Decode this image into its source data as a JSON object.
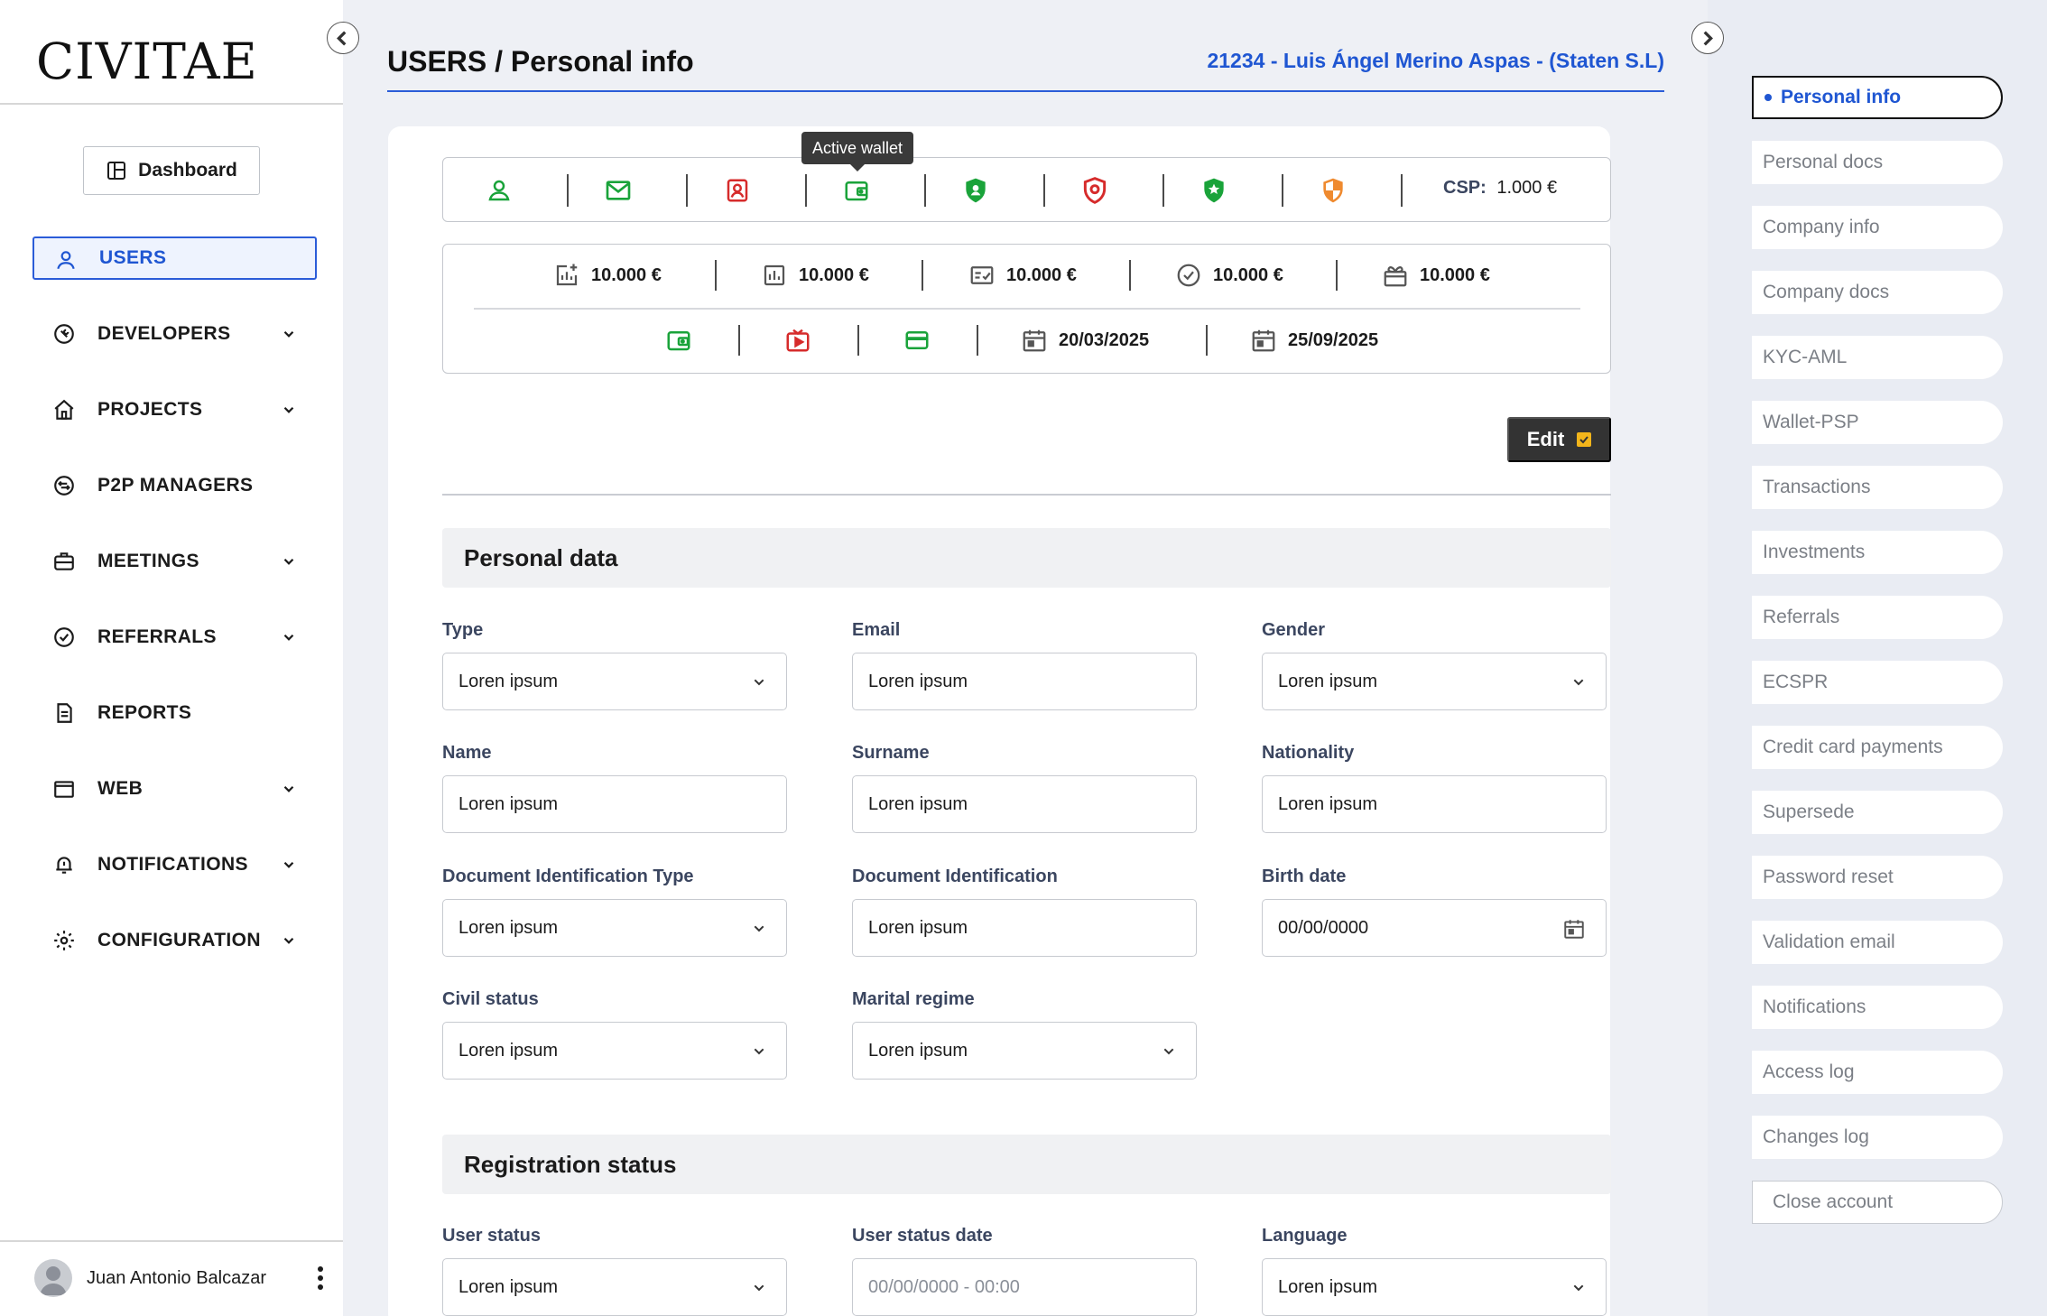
{
  "brand": {
    "logo": "CIVITAE"
  },
  "sidebar": {
    "dashboard_label": "Dashboard",
    "items": [
      {
        "label": "USERS",
        "icon": "user-icon",
        "expandable": false,
        "active": true
      },
      {
        "label": "DEVELOPERS",
        "icon": "wrench-icon",
        "expandable": true
      },
      {
        "label": "PROJECTS",
        "icon": "home-icon",
        "expandable": true
      },
      {
        "label": "P2P MANAGERS",
        "icon": "exchange-icon",
        "expandable": false
      },
      {
        "label": "MEETINGS",
        "icon": "briefcase-icon",
        "expandable": true
      },
      {
        "label": "REFERRALS",
        "icon": "check-circle-icon",
        "expandable": true
      },
      {
        "label": "REPORTS",
        "icon": "document-icon",
        "expandable": false
      },
      {
        "label": "WEB",
        "icon": "browser-icon",
        "expandable": true
      },
      {
        "label": "NOTIFICATIONS",
        "icon": "bell-icon",
        "expandable": true
      },
      {
        "label": "CONFIGURATION",
        "icon": "gear-icon",
        "expandable": true
      }
    ],
    "user_name": "Juan Antonio Balcazar"
  },
  "header": {
    "title": "USERS / Personal info",
    "user_ref": "21234 - Luis Ángel Merino Aspas - (Staten S.L)"
  },
  "status_bar": {
    "icons": [
      {
        "name": "user-status-icon",
        "color": "#1aa33a"
      },
      {
        "name": "email-status-icon",
        "color": "#1aa33a"
      },
      {
        "name": "identity-doc-icon",
        "color": "#d62b2b"
      },
      {
        "name": "wallet-status-icon",
        "color": "#1aa33a"
      },
      {
        "name": "shield-user-icon",
        "color": "#1aa33a"
      },
      {
        "name": "shield-alert-icon",
        "color": "#d62b2b"
      },
      {
        "name": "shield-star-icon",
        "color": "#1aa33a"
      },
      {
        "name": "shield-half-icon",
        "color": "#ef8a2f"
      }
    ],
    "tooltip": "Active wallet",
    "csp_label": "CSP:",
    "csp_value": "1.000 €"
  },
  "stats": {
    "row1": [
      {
        "icon": "chart-add-icon",
        "value": "10.000 €"
      },
      {
        "icon": "chart-bar-icon",
        "value": "10.000 €"
      },
      {
        "icon": "checklist-icon",
        "value": "10.000 €"
      },
      {
        "icon": "check-circle-icon",
        "value": "10.000 €"
      },
      {
        "icon": "gift-icon",
        "value": "10.000 €"
      }
    ],
    "row2": [
      {
        "icon": "wallet-icon",
        "color": "#1aa33a",
        "value": ""
      },
      {
        "icon": "video-icon",
        "color": "#d62b2b",
        "value": ""
      },
      {
        "icon": "credit-card-icon",
        "color": "#1aa33a",
        "value": ""
      },
      {
        "icon": "calendar-icon",
        "value": "20/03/2025"
      },
      {
        "icon": "calendar-icon",
        "value": "25/09/2025"
      }
    ]
  },
  "actions": {
    "edit_label": "Edit"
  },
  "personal_data": {
    "title": "Personal data",
    "fields": {
      "type": {
        "label": "Type",
        "value": "Loren ipsum"
      },
      "email": {
        "label": "Email",
        "value": "Loren ipsum"
      },
      "gender": {
        "label": "Gender",
        "value": "Loren ipsum"
      },
      "name": {
        "label": "Name",
        "value": "Loren ipsum"
      },
      "surname": {
        "label": "Surname",
        "value": "Loren ipsum"
      },
      "nationality": {
        "label": "Nationality",
        "value": "Loren ipsum"
      },
      "doc_type": {
        "label": "Document Identification Type",
        "value": "Loren ipsum"
      },
      "doc_id": {
        "label": "Document Identification",
        "value": "Loren ipsum"
      },
      "birth_date": {
        "label": "Birth date",
        "value": "00/00/0000"
      },
      "civil_status": {
        "label": "Civil status",
        "value": "Loren ipsum"
      },
      "marital_regime": {
        "label": "Marital regime",
        "value": "Loren ipsum"
      }
    }
  },
  "registration_status": {
    "title": "Registration status",
    "fields": {
      "user_status": {
        "label": "User status",
        "value": "Loren ipsum"
      },
      "user_status_date": {
        "label": "User status date",
        "placeholder": "00/00/0000 - 00:00"
      },
      "language": {
        "label": "Language",
        "value": "Loren ipsum"
      }
    }
  },
  "right_panel": {
    "items": [
      "Personal info",
      "Personal docs",
      "Company info",
      "Company docs",
      "KYC-AML",
      "Wallet-PSP",
      "Transactions",
      "Investments",
      "Referrals",
      "ECSPR",
      "Credit card payments",
      "Supersede",
      "Password reset",
      "Validation email",
      "Notifications",
      "Access log",
      "Changes log"
    ],
    "active_index": 0,
    "close_label": "Close account"
  },
  "colors": {
    "accent": "#1f56d2",
    "success": "#1aa33a",
    "danger": "#d62b2b",
    "warning": "#ef8a2f",
    "edit_check": "#f3b51b"
  }
}
